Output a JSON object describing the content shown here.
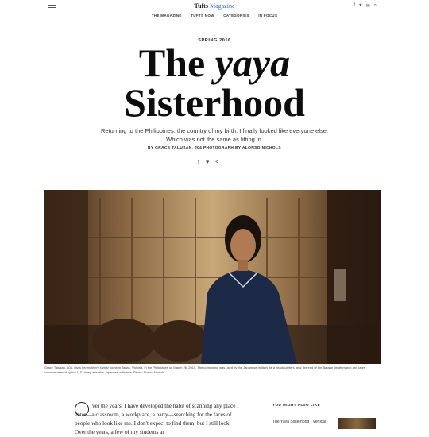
{
  "site": {
    "title": "Tufts",
    "title_accent": "Magazine"
  },
  "nav": [
    "THE MAGAZINE",
    "TUFTS NOW",
    "CATEGORIES",
    "IN FOCUS"
  ],
  "social_top": [
    "f",
    "♥",
    "✉",
    "⌕"
  ],
  "article": {
    "issue": "SPRING 2016",
    "headline_word1": "The",
    "headline_word2": "yaya",
    "headline_line2": "Sisterhood",
    "dek_line1": "Returning to the Philippines, the country of my birth, I finally looked like everyone else.",
    "dek_line2": "Which was not the same as fitting in.",
    "byline": "BY GRACE TALUSAN, J04  PHOTOGRAPH BY ALONSO NICHOLS",
    "share": [
      "f",
      "♥",
      "<"
    ],
    "caption": "Grace Talusan, A04, visits her mother's family home in Tarlac, Victoria, in the Philippines on March 26, 2015. The compound was used by the Japanese military as a headquarters near the end of the Bataan death march and later commandeered by the U.S. Army after the Japanese withdrew. Photo: Alonso Nichols",
    "body_p1": "ver the years, I have developed the habit of scanning any place I enter—a classroom, a workplace, a party—searching for the faces of people who look like me. I don't expect to find them, but I still look. Over the years, a few of my students at"
  },
  "aside": {
    "title": "YOU MIGHT ALSO LIKE",
    "item": "The Yaya Sisterhood - Vertical"
  }
}
